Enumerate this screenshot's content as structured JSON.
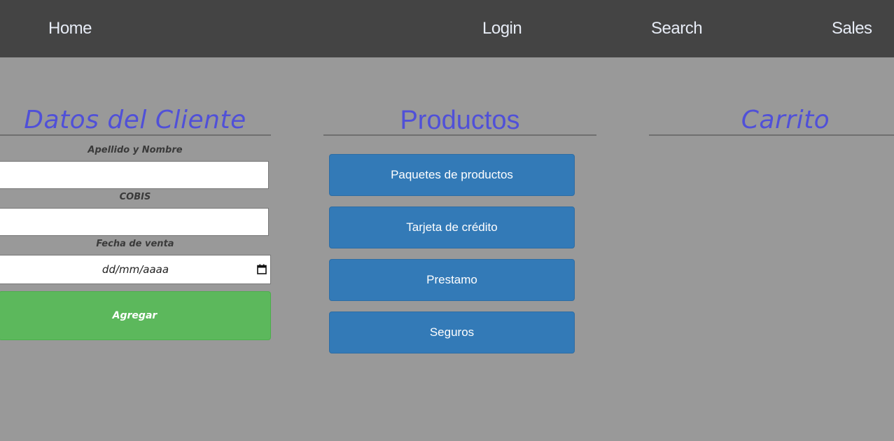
{
  "nav": {
    "home": "Home",
    "login": "Login",
    "search": "Search",
    "sales": "Sales"
  },
  "cliente": {
    "title": "Datos del Cliente",
    "apellido_label": "Apellido y Nombre",
    "apellido_value": "",
    "cobis_label": "COBIS",
    "cobis_value": "",
    "fecha_label": "Fecha de venta",
    "fecha_placeholder": "dd/mm/aaaa",
    "add_label": "Agregar"
  },
  "productos": {
    "title": "Productos",
    "items": [
      {
        "label": "Paquetes de productos"
      },
      {
        "label": "Tarjeta de crédito"
      },
      {
        "label": "Prestamo"
      },
      {
        "label": "Seguros"
      }
    ]
  },
  "carrito": {
    "title": "Carrito"
  },
  "colors": {
    "navbar": "#444444",
    "background": "#999999",
    "title": "#5050d8",
    "primary": "#337ab7",
    "success": "#5cb85c"
  }
}
